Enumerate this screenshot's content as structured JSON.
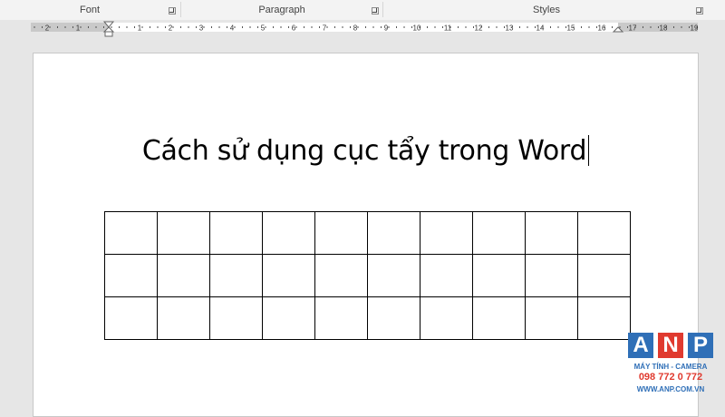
{
  "ribbon": {
    "groups": [
      {
        "label": "Font"
      },
      {
        "label": "Paragraph"
      },
      {
        "label": "Styles"
      }
    ]
  },
  "ruler": {
    "left_labels": [
      "2",
      "1"
    ],
    "right_labels": [
      "1",
      "2",
      "3",
      "4",
      "5",
      "6",
      "7",
      "8",
      "9",
      "10",
      "11",
      "12",
      "13",
      "14",
      "15",
      "16",
      "17",
      "18",
      "19"
    ]
  },
  "document": {
    "title": "Cách sử dụng cục tẩy trong Word",
    "table": {
      "rows": 3,
      "columns": 10
    }
  },
  "watermark": {
    "letters": [
      "A",
      "N",
      "P"
    ],
    "tagline": "MÁY TÍNH - CAMERA",
    "phone": "098 772 0 772",
    "website": "WWW.ANP.COM.VN",
    "colors": {
      "A": "#2f6fb7",
      "N": "#e03a2f",
      "P": "#2f6fb7",
      "accent": "#e03a2f"
    }
  },
  "colors": {
    "app_background": "#e6e6e6",
    "ribbon_background": "#f3f3f3",
    "page": "#ffffff"
  }
}
